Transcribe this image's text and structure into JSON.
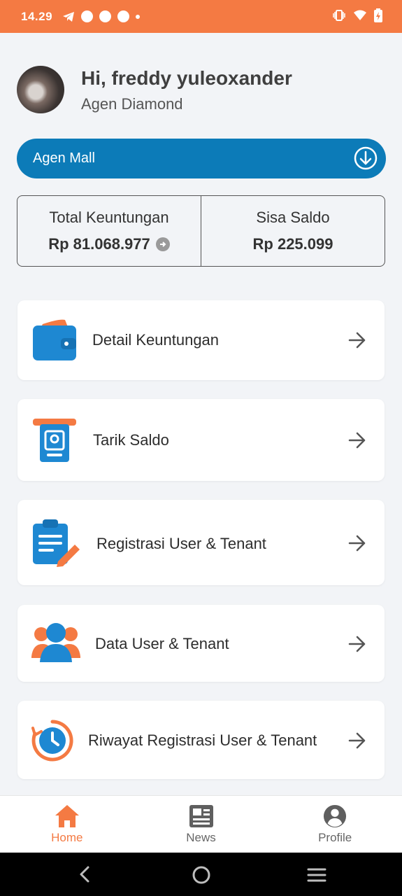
{
  "status_bar": {
    "time": "14.29",
    "color": "#f47a43"
  },
  "header": {
    "greeting": "Hi, freddy yuleoxander",
    "level": "Agen Diamond"
  },
  "mall_bar": {
    "label": "Agen Mall",
    "color": "#0c7bb8"
  },
  "stats": {
    "profit_label": "Total Keuntungan",
    "profit_value": "Rp 81.068.977",
    "balance_label": "Sisa Saldo",
    "balance_value": "Rp 225.099"
  },
  "menu": {
    "items": [
      {
        "label": "Detail Keuntungan",
        "icon": "wallet-icon"
      },
      {
        "label": "Tarik Saldo",
        "icon": "withdraw-icon"
      },
      {
        "label": "Registrasi User & Tenant",
        "icon": "clipboard-edit-icon"
      },
      {
        "label": "Data User & Tenant",
        "icon": "users-icon"
      },
      {
        "label": "Riwayat Registrasi User & Tenant",
        "icon": "history-clock-icon"
      }
    ]
  },
  "bottom_nav": {
    "items": [
      {
        "label": "Home",
        "icon": "home-icon",
        "active": true
      },
      {
        "label": "News",
        "icon": "news-icon",
        "active": false
      },
      {
        "label": "Profile",
        "icon": "profile-icon",
        "active": false
      }
    ],
    "active_color": "#f47a43"
  }
}
